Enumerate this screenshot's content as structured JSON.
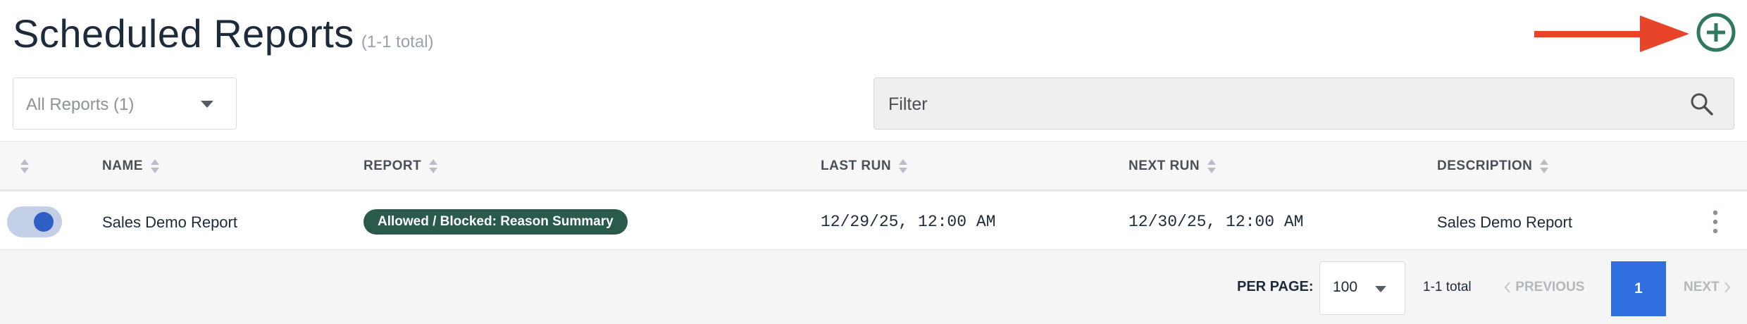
{
  "page": {
    "title": "Scheduled Reports",
    "count_text": "(1-1 total)"
  },
  "icons": {
    "add": "plus-circle-icon",
    "search": "search-icon",
    "sort": "sort-icon",
    "more": "kebab-icon",
    "annotation_arrow": "arrow-right-icon"
  },
  "colors": {
    "accent_green": "#2a5a4c",
    "add_icon": "#2f7a5e",
    "annotation_arrow": "#e8442a",
    "toggle_on": "#2f5fc4",
    "pagination_active": "#2f6fe0"
  },
  "report_filter": {
    "selected": "All Reports (1)"
  },
  "filter": {
    "placeholder": "Filter"
  },
  "table": {
    "columns": [
      "NAME",
      "REPORT",
      "LAST RUN",
      "NEXT RUN",
      "DESCRIPTION"
    ],
    "rows": [
      {
        "enabled": true,
        "name": "Sales Demo Report",
        "report": "Allowed / Blocked: Reason Summary",
        "last_run": "12/29/25, 12:00 AM",
        "next_run": "12/30/25, 12:00 AM",
        "description": "Sales Demo Report"
      }
    ]
  },
  "pagination": {
    "per_page_label": "PER PAGE:",
    "per_page_value": "100",
    "total": "1-1 total",
    "previous": "PREVIOUS",
    "current_page": "1",
    "next": "NEXT"
  }
}
